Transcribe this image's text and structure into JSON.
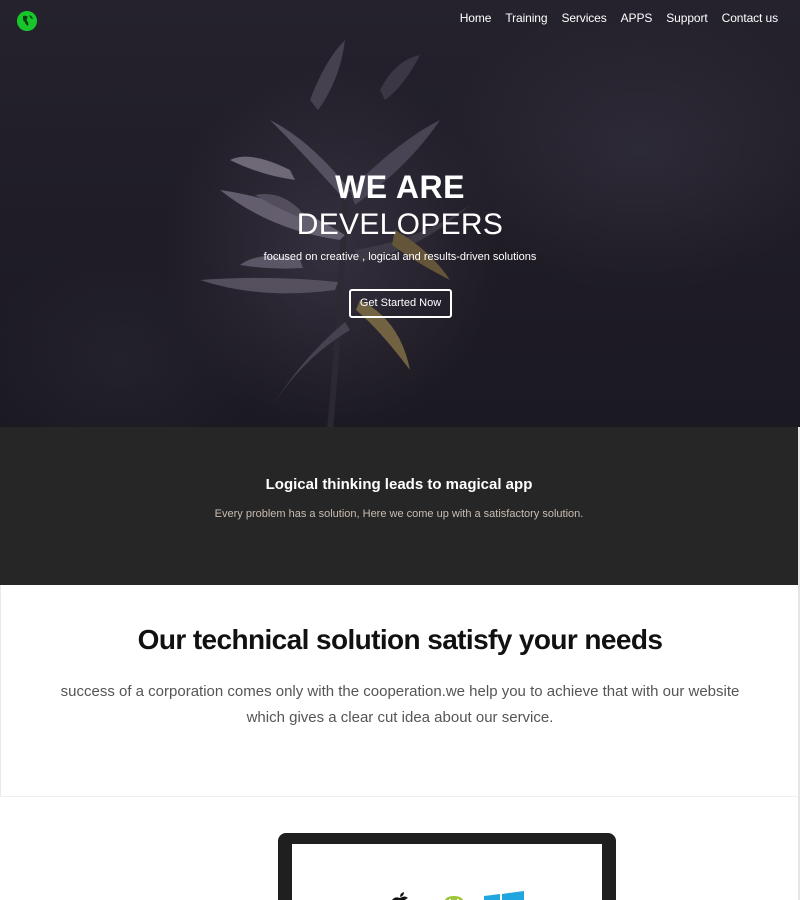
{
  "nav": {
    "items": [
      "Home",
      "Training",
      "Services",
      "APPS",
      "Support",
      "Contact us"
    ]
  },
  "hero": {
    "title_line1": "WE ARE",
    "title_line2": "DEVELOPERS",
    "tagline": "focused on creative , logical and results-driven solutions",
    "cta_label": "Get Started Now"
  },
  "band": {
    "title": "Logical thinking leads to magical app",
    "subtitle": "Every problem has a solution, Here we come up with a satisfactory solution."
  },
  "solution": {
    "title": "Our technical solution satisfy your needs",
    "text": "success of a corporation comes only with the cooperation.we help you to achieve that with our website which gives a clear cut idea about our service."
  },
  "icons": {
    "logo": "globe-logo",
    "os": [
      "apple-icon",
      "android-icon",
      "windows-icon"
    ]
  },
  "colors": {
    "logo_green": "#18c52a",
    "band_bg": "#262626",
    "android_green": "#9fc63a",
    "windows_blue": "#1fa6e0"
  }
}
